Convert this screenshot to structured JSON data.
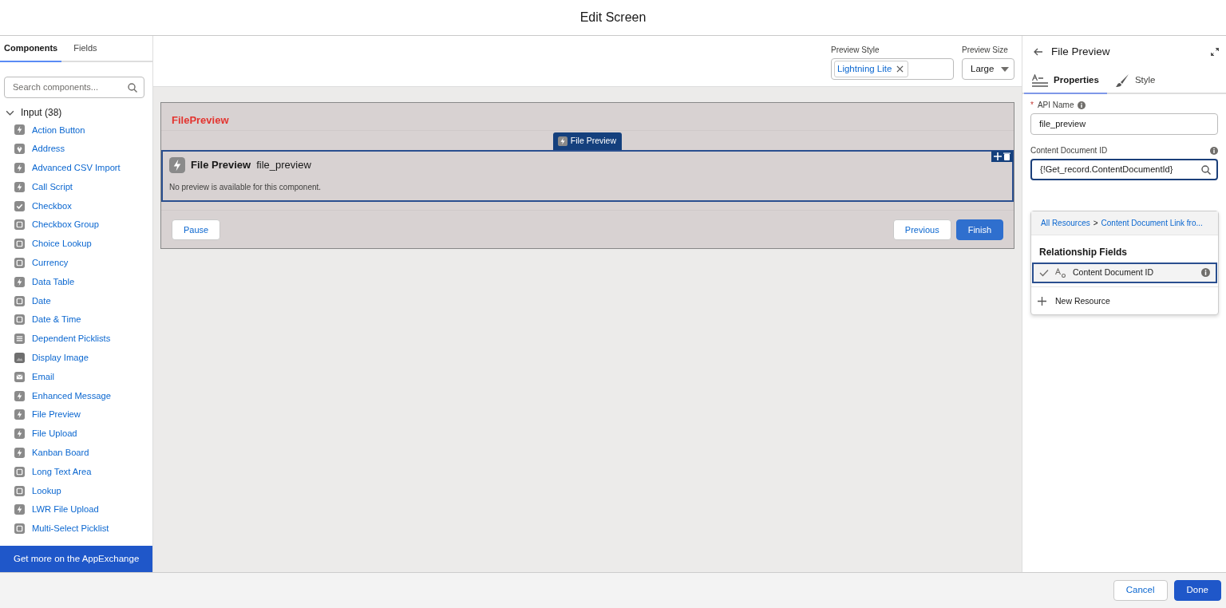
{
  "window": {
    "title": "Edit Screen"
  },
  "palette": {
    "tabs": [
      {
        "label": "Components",
        "selected": true
      },
      {
        "label": "Fields",
        "selected": false
      }
    ],
    "search": {
      "placeholder": "Search components..."
    },
    "section": {
      "label": "Input (38)",
      "expanded": true,
      "items": [
        {
          "label": "Action Button",
          "kind": "bolt"
        },
        {
          "label": "Address",
          "kind": "pin"
        },
        {
          "label": "Advanced CSV Import",
          "kind": "bolt"
        },
        {
          "label": "Call Script",
          "kind": "bolt"
        },
        {
          "label": "Checkbox",
          "kind": "check"
        },
        {
          "label": "Checkbox Group",
          "kind": "form"
        },
        {
          "label": "Choice Lookup",
          "kind": "form"
        },
        {
          "label": "Currency",
          "kind": "form"
        },
        {
          "label": "Data Table",
          "kind": "bolt"
        },
        {
          "label": "Date",
          "kind": "form"
        },
        {
          "label": "Date & Time",
          "kind": "form"
        },
        {
          "label": "Dependent Picklists",
          "kind": "list"
        },
        {
          "label": "Display Image",
          "kind": "image"
        },
        {
          "label": "Email",
          "kind": "mail"
        },
        {
          "label": "Enhanced Message",
          "kind": "bolt"
        },
        {
          "label": "File Preview",
          "kind": "bolt"
        },
        {
          "label": "File Upload",
          "kind": "bolt"
        },
        {
          "label": "Kanban Board",
          "kind": "bolt"
        },
        {
          "label": "Long Text Area",
          "kind": "form"
        },
        {
          "label": "Lookup",
          "kind": "form"
        },
        {
          "label": "LWR File Upload",
          "kind": "bolt"
        },
        {
          "label": "Multi-Select Picklist",
          "kind": "form"
        }
      ]
    },
    "footer_link": "Get more on the AppExchange"
  },
  "toolbar": {
    "preview_style": {
      "label": "Preview Style",
      "pill": "Lightning Lite"
    },
    "preview_size": {
      "label": "Preview Size",
      "value": "Large"
    }
  },
  "screen": {
    "title": "FilePreview",
    "component": {
      "tag": "File Preview",
      "title": "File Preview",
      "api_name": "file_preview",
      "message": "No preview is available for this component.",
      "selected": true
    },
    "buttons": [
      {
        "label": "Pause",
        "kind": "neutral"
      },
      {
        "label": "Previous",
        "kind": "neutral"
      },
      {
        "label": "Finish",
        "kind": "brand"
      }
    ]
  },
  "properties": {
    "title": "File Preview",
    "tabs": [
      {
        "label": "Properties",
        "kind": "text",
        "selected": true
      },
      {
        "label": "Style",
        "kind": "brush",
        "selected": false
      }
    ],
    "fields": [
      {
        "required_mark": "*",
        "label": "API Name",
        "value": "file_preview",
        "kind": "text",
        "focused": false
      },
      {
        "label": "Content Document ID",
        "value": "{!Get_record.ContentDocumentId}",
        "kind": "lookup",
        "focused": true
      }
    ],
    "dropdown": {
      "breadcrumb": [
        "All Resources",
        ">",
        "Content Document Link fro..."
      ],
      "group": "Relationship Fields",
      "options": [
        {
          "label": "Content Document ID",
          "selected": true
        }
      ],
      "action": "New Resource"
    }
  },
  "footer": {
    "buttons": [
      {
        "label": "Cancel",
        "kind": "neutral"
      },
      {
        "label": "Done",
        "kind": "brand"
      }
    ]
  }
}
